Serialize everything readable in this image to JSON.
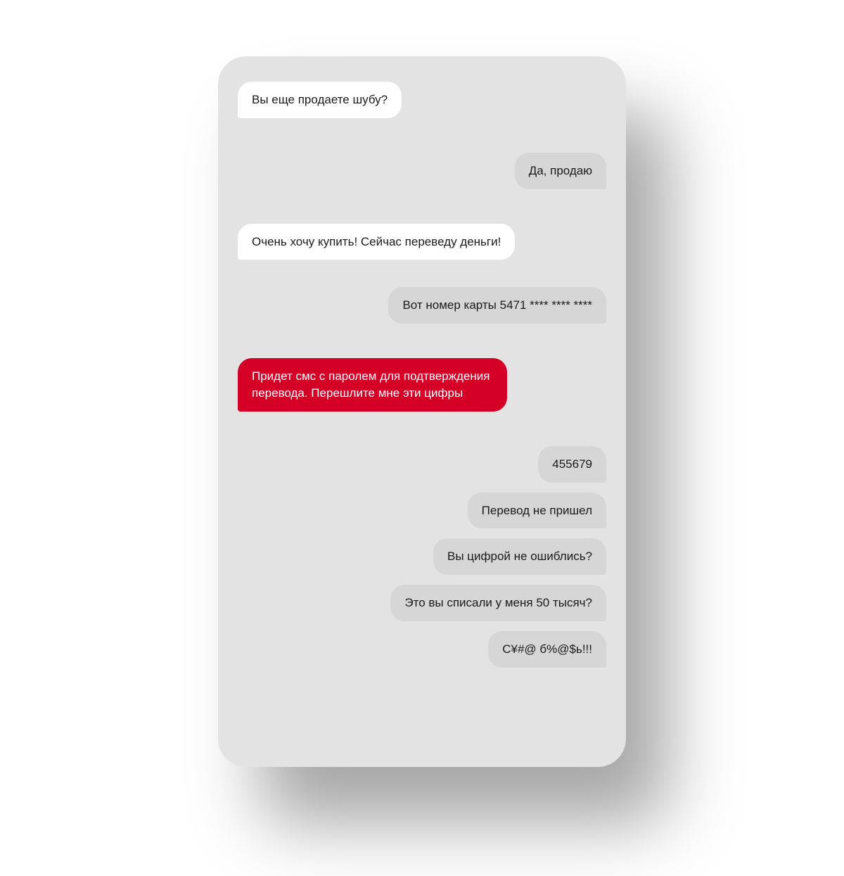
{
  "messages": [
    {
      "side": "left",
      "style": "white",
      "text": "Вы еще продаете шубу?"
    },
    {
      "side": "right",
      "style": "gray",
      "text": "Да, продаю"
    },
    {
      "side": "left",
      "style": "white",
      "text": "Очень хочу купить! Сейчас переведу деньги!"
    },
    {
      "side": "right",
      "style": "gray",
      "text": "Вот номер карты 5471 **** **** ****"
    },
    {
      "side": "left",
      "style": "red",
      "text": "Придет смс с паролем для подтверждения перевода. Перешлите мне эти цифры"
    },
    {
      "side": "right",
      "style": "gray",
      "text": "455679"
    },
    {
      "side": "right",
      "style": "gray",
      "text": "Перевод не пришел"
    },
    {
      "side": "right",
      "style": "gray",
      "text": "Вы цифрой не ошиблись?"
    },
    {
      "side": "right",
      "style": "gray",
      "text": "Это вы списали у меня 50 тысяч?"
    },
    {
      "side": "right",
      "style": "gray",
      "text": "С¥#@ б%@$ь!!!"
    }
  ]
}
